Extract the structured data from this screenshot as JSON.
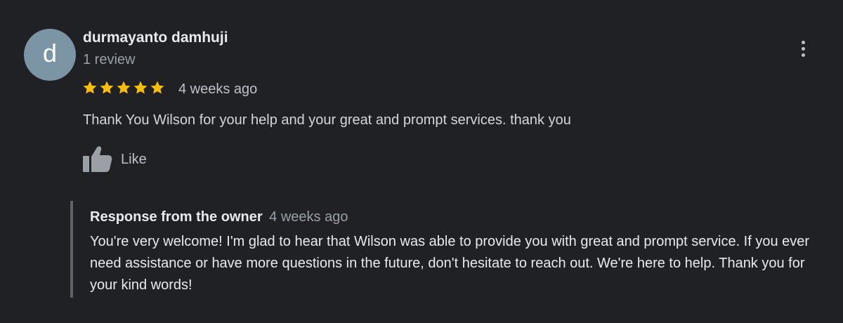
{
  "review": {
    "author": {
      "initial": "d",
      "name": "durmayanto damhuji",
      "review_count": "1 review",
      "avatar_color": "#7c95a5"
    },
    "rating": 5,
    "rating_max": 5,
    "star_color": "#fbbc04",
    "time": "4 weeks ago",
    "text": "Thank You Wilson for your help and your great and prompt services. thank you",
    "like_label": "Like",
    "menu_icon": "more-vert-icon"
  },
  "owner_response": {
    "label": "Response from the owner",
    "time": "4 weeks ago",
    "text": "You're very welcome! I'm glad to hear that Wilson was able to provide you with great and prompt service. If you ever need assistance or have more questions in the future, don't hesitate to reach out. We're here to help. Thank you for your kind words!"
  }
}
